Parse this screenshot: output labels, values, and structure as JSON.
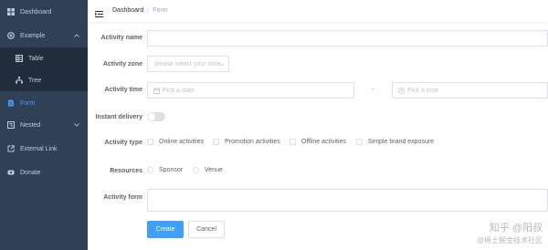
{
  "sidebar": {
    "items": [
      {
        "label": "Dashboard",
        "icon": "dashboard-icon"
      },
      {
        "label": "Example",
        "icon": "example-icon"
      },
      {
        "label": "Form",
        "icon": "form-icon"
      },
      {
        "label": "Nested",
        "icon": "nested-icon"
      },
      {
        "label": "External Link",
        "icon": "link-icon"
      },
      {
        "label": "Donate",
        "icon": "donate-icon"
      }
    ],
    "sub_items": [
      {
        "label": "Table",
        "icon": "table-icon"
      },
      {
        "label": "Tree",
        "icon": "tree-icon"
      }
    ],
    "active_color": "#409eff",
    "background": "#304156"
  },
  "breadcrumb": {
    "root": "Dashboard",
    "separator": "/",
    "current": "Form"
  },
  "form": {
    "name": {
      "label": "Activity name",
      "value": ""
    },
    "zone": {
      "label": "Activity zone",
      "placeholder": "please select your zone"
    },
    "time": {
      "label": "Activity time",
      "date_placeholder": "Pick a date",
      "separator": "-",
      "time_placeholder": "Pick a time"
    },
    "delivery": {
      "label": "Instant delivery",
      "on": false
    },
    "type": {
      "label": "Activity type",
      "options": [
        "Online activities",
        "Promotion activities",
        "Offline activities",
        "Simple brand exposure"
      ]
    },
    "resources": {
      "label": "Resources",
      "options": [
        "Sponsor",
        "Venue"
      ]
    },
    "desc": {
      "label": "Activity form",
      "value": ""
    },
    "buttons": {
      "create": "Create",
      "cancel": "Cancel"
    }
  },
  "watermark": {
    "line1": "知乎 @阳叔",
    "line2": "@稀土掘金技术社区"
  }
}
